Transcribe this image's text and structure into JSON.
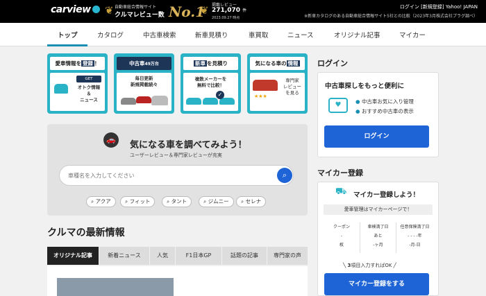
{
  "header": {
    "logo": "carview",
    "award_small": "自動車総合情報サイト",
    "award_big": "クルマレビュー数",
    "award_rank": "No.1",
    "count_label": "掲載レビュー",
    "count_value": "271,070",
    "count_unit": "件",
    "count_date": "2023.09.27 時点",
    "links": "ログイン [新規登録]  Yahoo! JAPAN",
    "note": "※新車カタログのある自動車総合情報サイト5社との比較（2023年3月株式会社プラグ調べ）"
  },
  "nav": [
    "トップ",
    "カタログ",
    "中古車検索",
    "新車見積り",
    "車買取",
    "ニュース",
    "オリジナル記事",
    "マイカー"
  ],
  "cards": [
    {
      "head_pre": "愛車情報を",
      "head_hl": "登録",
      "head_post": "！",
      "tag": "GET",
      "text": "オトク情報\n＆\nニュース"
    },
    {
      "head_pre": "中古車",
      "head_hl": "49万台",
      "head_post": "",
      "text": "毎日更新\n新規掲載続々"
    },
    {
      "head_pre": "新車",
      "head_hl": "を見積り",
      "head_post": "",
      "text": "複数メーカーを\n無料で比較！"
    },
    {
      "head_pre": "気になる車の",
      "head_hl": "情報",
      "head_post": "",
      "text": "専門家\nレビュー\nを見る"
    }
  ],
  "search": {
    "title": "気になる車を調べてみよう！",
    "subtitle": "ユーザーレビュー＆専門家レビューが充実",
    "placeholder": "車種名を入力してください",
    "tags": [
      "アクア",
      "フィット",
      "タント",
      "ジムニー",
      "セレナ"
    ]
  },
  "news": {
    "title": "クルマの最新情報",
    "tabs": [
      "オリジナル記事",
      "新着ニュース",
      "人気",
      "F1日本GP",
      "話題の記事",
      "専門家の声"
    ]
  },
  "login": {
    "heading": "ログイン",
    "title": "中古車探しをもっと便利に",
    "bullets": [
      "中古車お気に入り管理",
      "おすすめ中古車の表示"
    ],
    "button": "ログイン"
  },
  "mycar": {
    "heading": "マイカー登録",
    "title": "マイカー登録しよう！",
    "band": "愛車管理はマイカーページで！",
    "cols": [
      {
        "label": "クーポン",
        "v1": "-",
        "v2": "枚"
      },
      {
        "label": "車検満了日",
        "v1": "あと",
        "v2": "-ヶ月"
      },
      {
        "label": "任意保険満了日",
        "v1": "- - - -年",
        "v2": "-月-日"
      }
    ],
    "note_pre": "3",
    "note_post": "項目入力すればOK",
    "button": "マイカー登録をする"
  },
  "colors": {
    "accent": "#1a8fb3",
    "teal": "#2ab3c6",
    "blue": "#1e64d6",
    "navy": "#1d3557"
  }
}
